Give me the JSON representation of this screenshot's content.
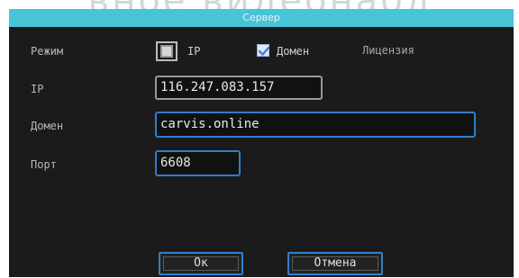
{
  "background_watermark": "вное видеонабл",
  "dialog": {
    "title": "Сервер",
    "mode": {
      "label": "Режим",
      "options": [
        {
          "label": "IP",
          "checked": false
        },
        {
          "label": "Домен",
          "checked": true
        },
        {
          "label": "Лицензия"
        }
      ]
    },
    "ip": {
      "label": "IP",
      "value": "116.247.083.157"
    },
    "domain": {
      "label": "Домен",
      "value": "carvis.online"
    },
    "port": {
      "label": "Порт",
      "value": "6608"
    },
    "buttons": {
      "ok": "Ок",
      "cancel": "Отмена"
    }
  },
  "colors": {
    "title_bar": "#47c4d6",
    "dialog_bg": "#1b1b1b",
    "field_border": "#2f7fc9",
    "label_text": "#b8b8b8"
  }
}
